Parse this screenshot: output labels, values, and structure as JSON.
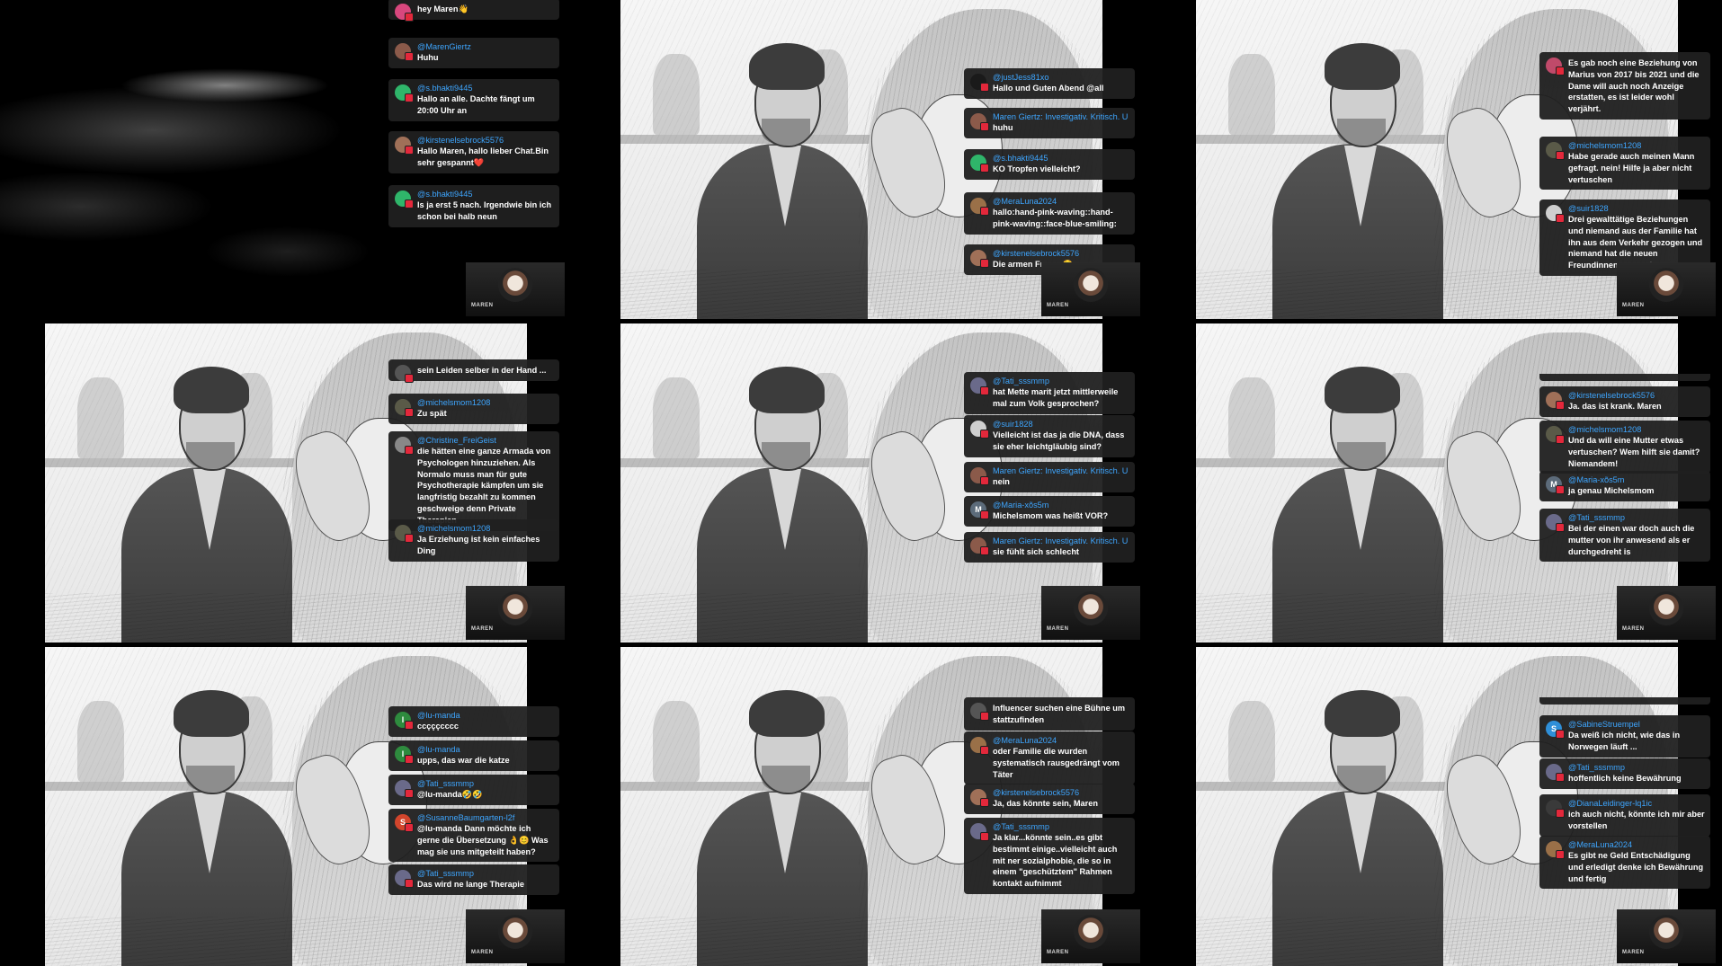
{
  "host_label": "MAREN",
  "colors": {
    "username": "#3ea6ff",
    "bubble": "#202020",
    "text": "#ffffff",
    "live_badge": "#e3283b"
  },
  "tiles": [
    {
      "bg": "smoke",
      "top_bar": false,
      "messages": [
        {
          "user": "",
          "text": "hey Maren👋",
          "avatar": "",
          "color": "#d8477d",
          "noname": true
        },
        {
          "user": "@MarenGiertz",
          "text": "Huhu",
          "avatar": "",
          "color": "#8b5a4a"
        },
        {
          "user": "@s.bhakti9445",
          "text": "Hallo an alle. Dachte fängt um 20:00 Uhr an",
          "avatar": "",
          "color": "#2fb56a"
        },
        {
          "user": "@kirstenelsebrock5576",
          "text": "Hallo Maren, hallo lieber Chat.Bin sehr gespannt❤️",
          "avatar": "",
          "color": "#a07058"
        },
        {
          "user": "@s.bhakti9445",
          "text": "Is ja erst 5 nach. Irgendwie bin ich schon bei halb neun",
          "avatar": "",
          "color": "#2fb56a"
        }
      ]
    },
    {
      "bg": "sketch",
      "top_bar": false,
      "messages": [
        {
          "user": "@justJess81xo",
          "text": "Hallo und Guten Abend @all",
          "avatar": "",
          "color": "#1a1a1a"
        },
        {
          "user": "Maren Giertz: Investigativ. Kritisch. U",
          "text": "huhu",
          "avatar": "",
          "color": "#8b5a4a"
        },
        {
          "user": "@s.bhakti9445",
          "text": "KO Tropfen vielleicht?",
          "avatar": "",
          "color": "#2fb56a"
        },
        {
          "user": "@MeraLuna2024",
          "text": "hallo:hand-pink-waving::hand-pink-waving::face-blue-smiling:",
          "avatar": "",
          "color": "#9a7048"
        },
        {
          "user": "@kirstenelsebrock5576",
          "text": "Die armen Frauen😳",
          "avatar": "",
          "color": "#a07058"
        }
      ]
    },
    {
      "bg": "sketch",
      "top_bar": false,
      "messages": [
        {
          "user": "",
          "text": "Es gab noch eine Beziehung von Marius von 2017 bis 2021 und die Dame will auch noch Anzeige erstatten, es ist leider wohl verjährt.",
          "avatar": "",
          "color": "#c04a6a",
          "noname": true
        },
        {
          "user": "@michelsmom1208",
          "text": "Habe gerade auch meinen Mann gefragt. nein! Hilfe ja aber nicht vertuschen",
          "avatar": "",
          "color": "#5a5a48"
        },
        {
          "user": "@suir1828",
          "text": "Drei gewalttätige Beziehungen und niemand aus der Familie hat ihn aus dem Verkehr gezogen und niemand hat die neuen Freundinnen gewarnt.",
          "avatar": "",
          "color": "#cfcfcf"
        }
      ]
    },
    {
      "bg": "sketch",
      "top_bar": false,
      "messages": [
        {
          "user": "",
          "text": "sein Leiden selber in der Hand ...",
          "avatar": "",
          "color": "#555555",
          "noname": true
        },
        {
          "user": "@michelsmom1208",
          "text": "Zu spät",
          "avatar": "",
          "color": "#5a5a48"
        },
        {
          "user": "@Christine_FreiGeist",
          "text": "die hätten eine ganze Armada von Psychologen hinzuziehen. Als Normalo muss man für gute Psychotherapie kämpfen um sie langfristig bezahlt zu kommen geschweige denn Private Therapien",
          "avatar": "",
          "color": "#888888"
        },
        {
          "user": "@michelsmom1208",
          "text": "Ja Erziehung ist kein einfaches Ding",
          "avatar": "",
          "color": "#5a5a48"
        }
      ]
    },
    {
      "bg": "sketch",
      "top_bar": false,
      "messages": [
        {
          "user": "@Tati_sssmmp",
          "text": "hat Mette marit jetzt mittlerweile mal zum Volk gesprochen?",
          "avatar": "",
          "color": "#6a6a8a"
        },
        {
          "user": "@suir1828",
          "text": "Vielleicht ist das ja die DNA, dass sie eher leichtgläubig sind?",
          "avatar": "",
          "color": "#cfcfcf"
        },
        {
          "user": "Maren Giertz: Investigativ. Kritisch. U",
          "text": "nein",
          "avatar": "",
          "color": "#8b5a4a"
        },
        {
          "user": "@Maria-xõs5m",
          "text": "Michelsmom was heißt VOR?",
          "avatar": "M",
          "color": "#5c6b7a"
        },
        {
          "user": "Maren Giertz: Investigativ. Kritisch. U",
          "text": "sie fühlt sich schlecht",
          "avatar": "",
          "color": "#8b5a4a"
        }
      ]
    },
    {
      "bg": "sketch",
      "top_bar": true,
      "messages": [
        {
          "user": "@kirstenelsebrock5576",
          "text": "Ja. das ist krank. Maren",
          "avatar": "",
          "color": "#a07058"
        },
        {
          "user": "@michelsmom1208",
          "text": "Und da will eine Mutter etwas vertuschen? Wem hilft sie damit? Niemandem!",
          "avatar": "",
          "color": "#5a5a48"
        },
        {
          "user": "@Maria-xõs5m",
          "text": "ja genau Michelsmom",
          "avatar": "M",
          "color": "#5c6b7a"
        },
        {
          "user": "@Tati_sssmmp",
          "text": "Bei der einen war doch auch die mutter von ihr anwesend als er durchgedreht is",
          "avatar": "",
          "color": "#6a6a8a"
        }
      ]
    },
    {
      "bg": "sketch",
      "top_bar": false,
      "messages": [
        {
          "user": "@lu-manda",
          "text": "ccçççcccc",
          "avatar": "l",
          "color": "#2e8b3e"
        },
        {
          "user": "@lu-manda",
          "text": "upps, das war die katze",
          "avatar": "l",
          "color": "#2e8b3e"
        },
        {
          "user": "@Tati_sssmmp",
          "text": "@lu-manda🤣🤣",
          "avatar": "",
          "color": "#6a6a8a"
        },
        {
          "user": "@SusanneBaumgarten-l2f",
          "text": "@lu-manda Dann möchte ich gerne die Übersetzung 👌😊 Was mag sie uns mitgeteilt haben?",
          "avatar": "S",
          "color": "#d2452c"
        },
        {
          "user": "@Tati_sssmmp",
          "text": "Das wird ne lange Therapie",
          "avatar": "",
          "color": "#6a6a8a"
        }
      ]
    },
    {
      "bg": "sketch",
      "top_bar": false,
      "messages": [
        {
          "user": "",
          "text": "Influencer suchen eine Bühne um stattzufinden",
          "avatar": "",
          "color": "#555555",
          "noname": true
        },
        {
          "user": "@MeraLuna2024",
          "text": "oder Familie die wurden systematisch rausgedrängt vom Täter",
          "avatar": "",
          "color": "#9a7048"
        },
        {
          "user": "@kirstenelsebrock5576",
          "text": "Ja, das könnte sein, Maren",
          "avatar": "",
          "color": "#a07058"
        },
        {
          "user": "@Tati_sssmmp",
          "text": "Ja klar...könnte sein..es gibt bestimmt einige..vielleicht auch mit ner sozialphobie, die so in einem \"geschütztem\" Rahmen kontakt aufnimmt",
          "avatar": "",
          "color": "#6a6a8a"
        }
      ]
    },
    {
      "bg": "sketch",
      "top_bar": true,
      "messages": [
        {
          "user": "@SabineStruempel",
          "text": "Da weiß ich nicht, wie das in Norwegen läuft ...",
          "avatar": "S",
          "color": "#2f8fd8"
        },
        {
          "user": "@Tati_sssmmp",
          "text": "hoffentlich keine Bewährung",
          "avatar": "",
          "color": "#6a6a8a"
        },
        {
          "user": "@DianaLeidinger-lq1ic",
          "text": "ich auch nicht, könnte ich mir aber vorstellen",
          "avatar": "",
          "color": "#3a3a3a"
        },
        {
          "user": "@MeraLuna2024",
          "text": "Es gibt ne Geld Entschädigung und erledigt denke ich Bewährung und fertig",
          "avatar": "",
          "color": "#9a7048"
        }
      ]
    }
  ]
}
